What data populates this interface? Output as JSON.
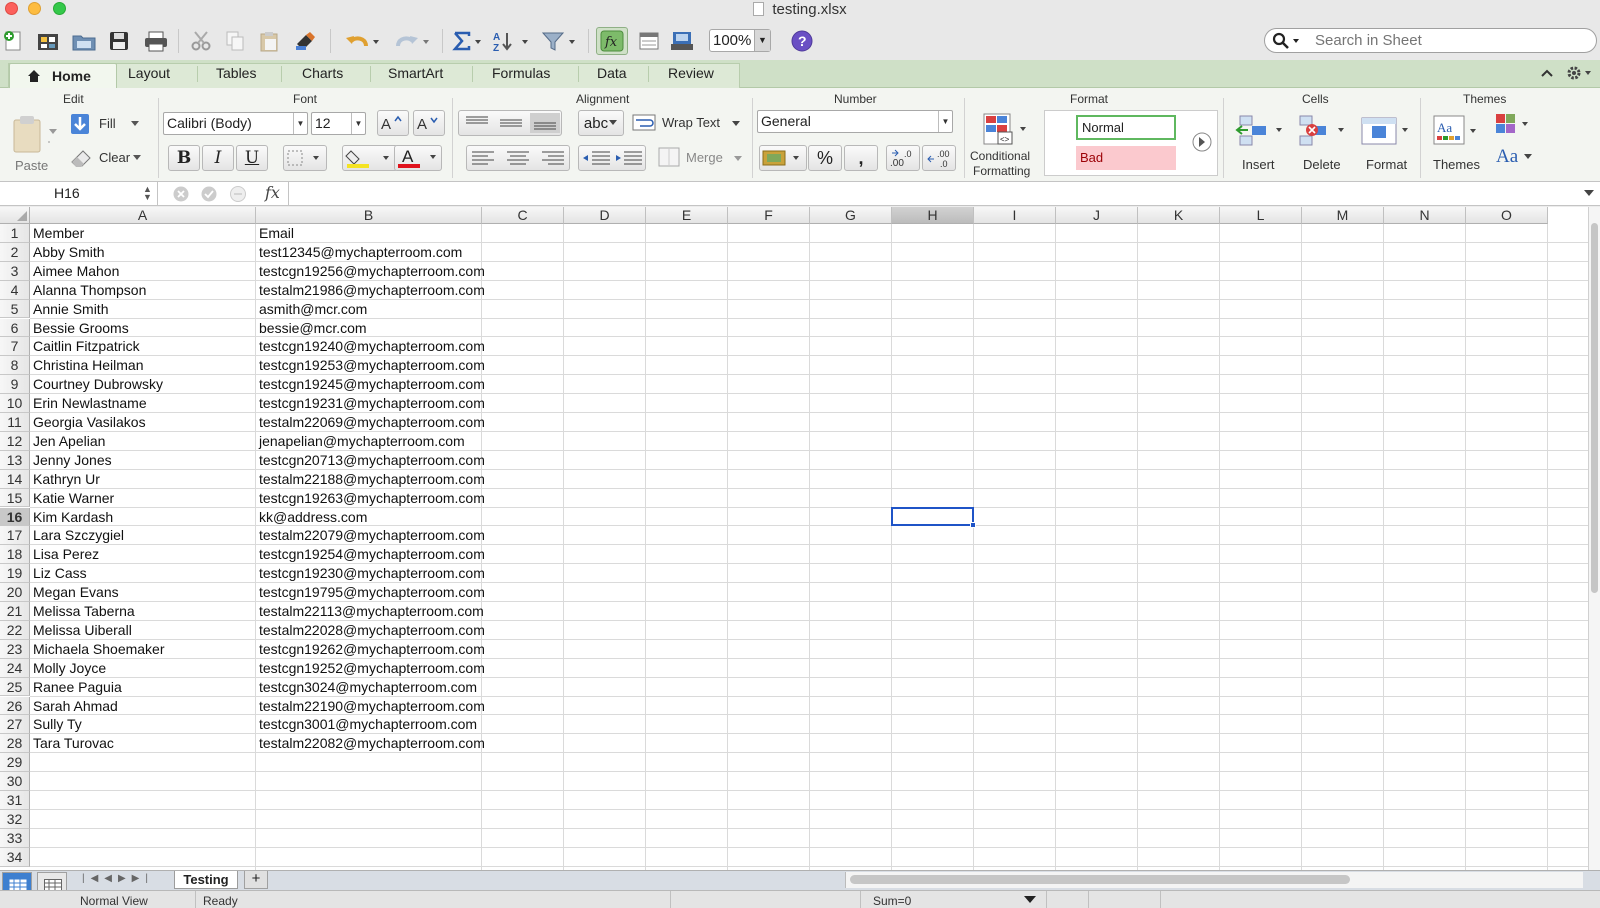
{
  "window": {
    "title": "testing.xlsx"
  },
  "toolbar": {
    "zoom": "100%",
    "search_placeholder": "Search in Sheet"
  },
  "ribbon_tabs": [
    "Home",
    "Layout",
    "Tables",
    "Charts",
    "SmartArt",
    "Formulas",
    "Data",
    "Review"
  ],
  "ribbon": {
    "groups": {
      "edit": "Edit",
      "font": "Font",
      "alignment": "Alignment",
      "number": "Number",
      "format": "Format",
      "cells": "Cells",
      "themes": "Themes"
    },
    "paste": "Paste",
    "fill": "Fill",
    "clear": "Clear",
    "font_name": "Calibri (Body)",
    "font_size": "12",
    "bold": "B",
    "italic": "I",
    "underline": "U",
    "wrap_text": "Wrap Text",
    "merge": "Merge",
    "abc": "abc",
    "number_format": "General",
    "percent": "%",
    "comma": ",",
    "conditional_formatting_1": "Conditional",
    "conditional_formatting_2": "Formatting",
    "style_normal": "Normal",
    "style_bad": "Bad",
    "insert": "Insert",
    "delete": "Delete",
    "format": "Format",
    "themes": "Themes",
    "aa": "Aa"
  },
  "formula_bar": {
    "name_box": "H16",
    "fx": "fx",
    "formula": ""
  },
  "sheet": {
    "columns": [
      "A",
      "B",
      "C",
      "D",
      "E",
      "F",
      "G",
      "H",
      "I",
      "J",
      "K",
      "L",
      "M",
      "N",
      "O"
    ],
    "selected_column": "H",
    "selected_row": "16",
    "row_numbers": [
      "1",
      "2",
      "3",
      "4",
      "5",
      "6",
      "7",
      "8",
      "9",
      "10",
      "11",
      "12",
      "13",
      "14",
      "15",
      "16",
      "17",
      "18",
      "19",
      "20",
      "21",
      "22",
      "23",
      "24",
      "25",
      "26",
      "27",
      "28",
      "29",
      "30",
      "31",
      "32",
      "33",
      "34"
    ],
    "rows": [
      [
        "Member",
        "Email"
      ],
      [
        "Abby Smith",
        "test12345@mychapterroom.com"
      ],
      [
        "Aimee Mahon",
        "testcgn19256@mychapterroom.com"
      ],
      [
        "Alanna Thompson",
        "testalm21986@mychapterroom.com"
      ],
      [
        "Annie Smith",
        "asmith@mcr.com"
      ],
      [
        "Bessie Grooms",
        "bessie@mcr.com"
      ],
      [
        "Caitlin Fitzpatrick",
        "testcgn19240@mychapterroom.com"
      ],
      [
        "Christina Heilman",
        "testcgn19253@mychapterroom.com"
      ],
      [
        "Courtney Dubrowsky",
        "testcgn19245@mychapterroom.com"
      ],
      [
        "Erin Newlastname",
        "testcgn19231@mychapterroom.com"
      ],
      [
        "Georgia Vasilakos",
        "testalm22069@mychapterroom.com"
      ],
      [
        "Jen Apelian",
        "jenapelian@mychapterroom.com"
      ],
      [
        "Jenny Jones",
        "testcgn20713@mychapterroom.com"
      ],
      [
        "Kathryn Ur",
        "testalm22188@mychapterroom.com"
      ],
      [
        "Katie Warner",
        "testcgn19263@mychapterroom.com"
      ],
      [
        "Kim Kardash",
        "kk@address.com"
      ],
      [
        "Lara Szczygiel",
        "testalm22079@mychapterroom.com"
      ],
      [
        "Lisa Perez",
        "testcgn19254@mychapterroom.com"
      ],
      [
        "Liz Cass",
        "testcgn19230@mychapterroom.com"
      ],
      [
        "Megan Evans",
        "testcgn19795@mychapterroom.com"
      ],
      [
        "Melissa Taberna",
        "testalm22113@mychapterroom.com"
      ],
      [
        "Melissa Uiberall",
        "testalm22028@mychapterroom.com"
      ],
      [
        "Michaela Shoemaker",
        "testcgn19262@mychapterroom.com"
      ],
      [
        "Molly Joyce",
        "testcgn19252@mychapterroom.com"
      ],
      [
        "Ranee Paguia",
        "testcgn3024@mychapterroom.com"
      ],
      [
        "Sarah Ahmad",
        "testalm22190@mychapterroom.com"
      ],
      [
        "Sully Ty",
        "testcgn3001@mychapterroom.com"
      ],
      [
        "Tara Turovac",
        "testalm22082@mychapterroom.com"
      ]
    ]
  },
  "sheet_tabs": {
    "active": "Testing",
    "add": "+"
  },
  "status_bar": {
    "view": "Normal View",
    "state": "Ready",
    "sum": "Sum=0"
  },
  "colors": {
    "ribbon_tab_bar": "#cfe0c7",
    "selection": "#1f54c7",
    "style_bad_bg": "#fbc9ce",
    "style_normal_border": "#5fb85f"
  }
}
